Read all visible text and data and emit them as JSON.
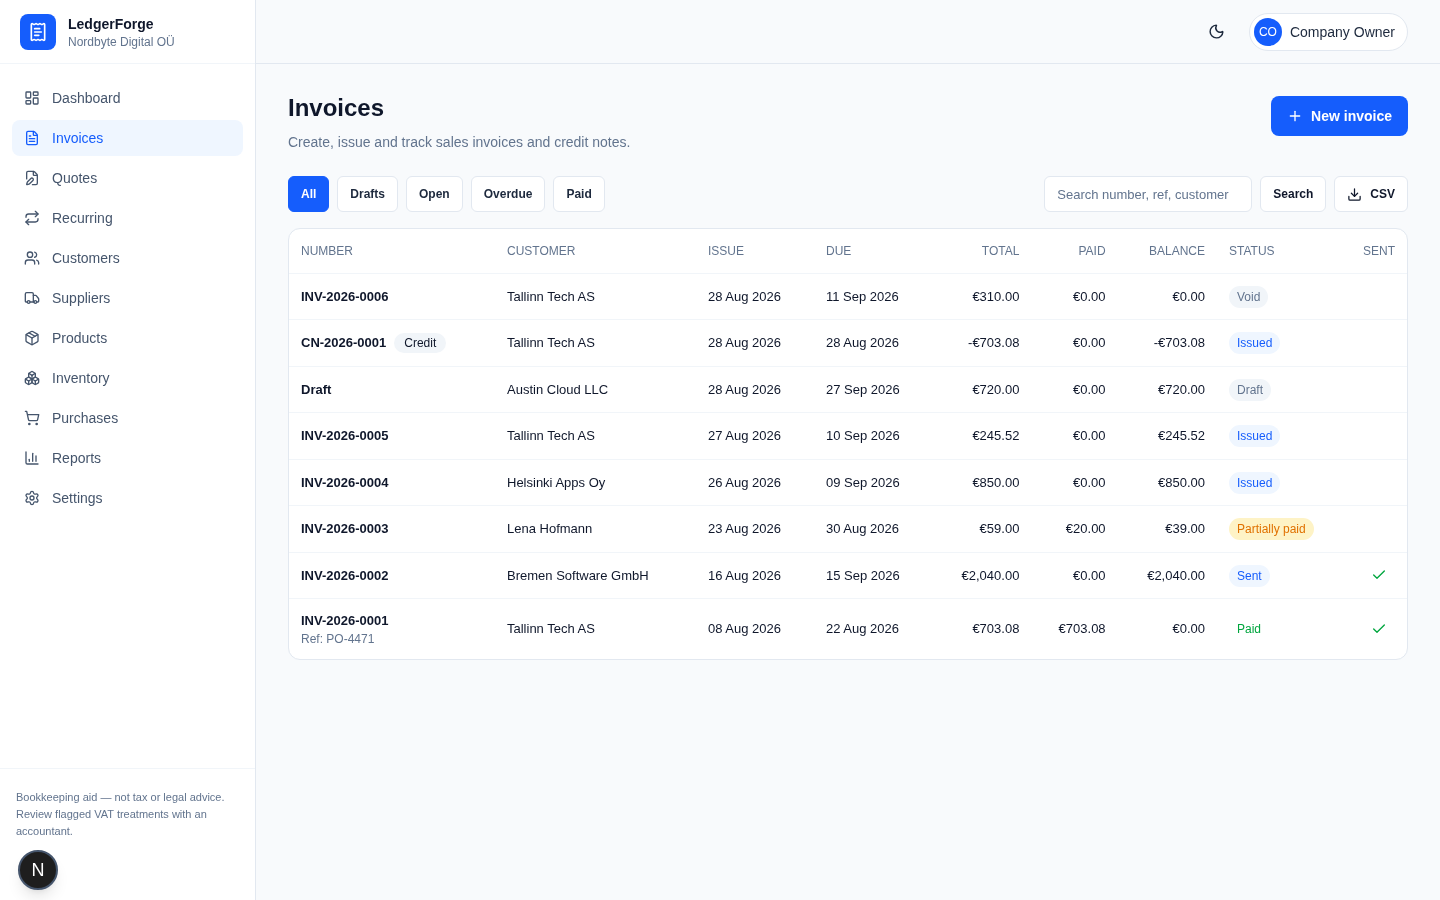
{
  "brand": {
    "name": "LedgerForge",
    "company": "Nordbyte Digital OÜ"
  },
  "sidebar": {
    "items": [
      {
        "label": "Dashboard",
        "selected": false
      },
      {
        "label": "Invoices",
        "selected": true
      },
      {
        "label": "Quotes",
        "selected": false
      },
      {
        "label": "Recurring",
        "selected": false
      },
      {
        "label": "Customers",
        "selected": false
      },
      {
        "label": "Suppliers",
        "selected": false
      },
      {
        "label": "Products",
        "selected": false
      },
      {
        "label": "Inventory",
        "selected": false
      },
      {
        "label": "Purchases",
        "selected": false
      },
      {
        "label": "Reports",
        "selected": false
      },
      {
        "label": "Settings",
        "selected": false
      }
    ],
    "footer": "Bookkeeping aid — not tax or legal advice. Review flagged VAT treatments with an accountant."
  },
  "dev_badge": "N",
  "header": {
    "user_initials": "CO",
    "user_name": "Company Owner"
  },
  "page": {
    "title": "Invoices",
    "subtitle": "Create, issue and track sales invoices and credit notes.",
    "new_button": "New invoice"
  },
  "filters": [
    {
      "label": "All",
      "selected": true
    },
    {
      "label": "Drafts",
      "selected": false
    },
    {
      "label": "Open",
      "selected": false
    },
    {
      "label": "Overdue",
      "selected": false
    },
    {
      "label": "Paid",
      "selected": false
    }
  ],
  "search": {
    "placeholder": "Search number, ref, customer",
    "button": "Search",
    "export": "CSV"
  },
  "table": {
    "columns": [
      "NUMBER",
      "CUSTOMER",
      "ISSUE",
      "DUE",
      "TOTAL",
      "PAID",
      "BALANCE",
      "STATUS",
      "SENT"
    ],
    "rows": [
      {
        "number": "INV-2026-0006",
        "customer": "Tallinn Tech AS",
        "issue": "28 Aug 2026",
        "due": "11 Sep 2026",
        "total": "€310.00",
        "paid": "€0.00",
        "balance": "€0.00",
        "status": "Void",
        "kind": "void",
        "sent": false
      },
      {
        "number": "CN-2026-0001",
        "tag": "Credit",
        "customer": "Tallinn Tech AS",
        "issue": "28 Aug 2026",
        "due": "28 Aug 2026",
        "total": "-€703.08",
        "paid": "€0.00",
        "balance": "-€703.08",
        "status": "Issued",
        "kind": "issued",
        "sent": false
      },
      {
        "number": "Draft",
        "customer": "Austin Cloud LLC",
        "issue": "28 Aug 2026",
        "due": "27 Sep 2026",
        "total": "€720.00",
        "paid": "€0.00",
        "balance": "€720.00",
        "status": "Draft",
        "kind": "draft",
        "sent": false
      },
      {
        "number": "INV-2026-0005",
        "customer": "Tallinn Tech AS",
        "issue": "27 Aug 2026",
        "due": "10 Sep 2026",
        "total": "€245.52",
        "paid": "€0.00",
        "balance": "€245.52",
        "status": "Issued",
        "kind": "issued",
        "sent": false
      },
      {
        "number": "INV-2026-0004",
        "customer": "Helsinki Apps Oy",
        "issue": "26 Aug 2026",
        "due": "09 Sep 2026",
        "total": "€850.00",
        "paid": "€0.00",
        "balance": "€850.00",
        "status": "Issued",
        "kind": "issued",
        "sent": false
      },
      {
        "number": "INV-2026-0003",
        "customer": "Lena Hofmann",
        "issue": "23 Aug 2026",
        "due": "30 Aug 2026",
        "total": "€59.00",
        "paid": "€20.00",
        "balance": "€39.00",
        "status": "Partially paid",
        "kind": "partial",
        "sent": false
      },
      {
        "number": "INV-2026-0002",
        "customer": "Bremen Software GmbH",
        "issue": "16 Aug 2026",
        "due": "15 Sep 2026",
        "total": "€2,040.00",
        "paid": "€0.00",
        "balance": "€2,040.00",
        "status": "Sent",
        "kind": "sent",
        "sent": true
      },
      {
        "number": "INV-2026-0001",
        "ref": "Ref: PO-4471",
        "customer": "Tallinn Tech AS",
        "issue": "08 Aug 2026",
        "due": "22 Aug 2026",
        "total": "€703.08",
        "paid": "€703.08",
        "balance": "€0.00",
        "status": "Paid",
        "kind": "paid",
        "sent": true
      }
    ]
  }
}
